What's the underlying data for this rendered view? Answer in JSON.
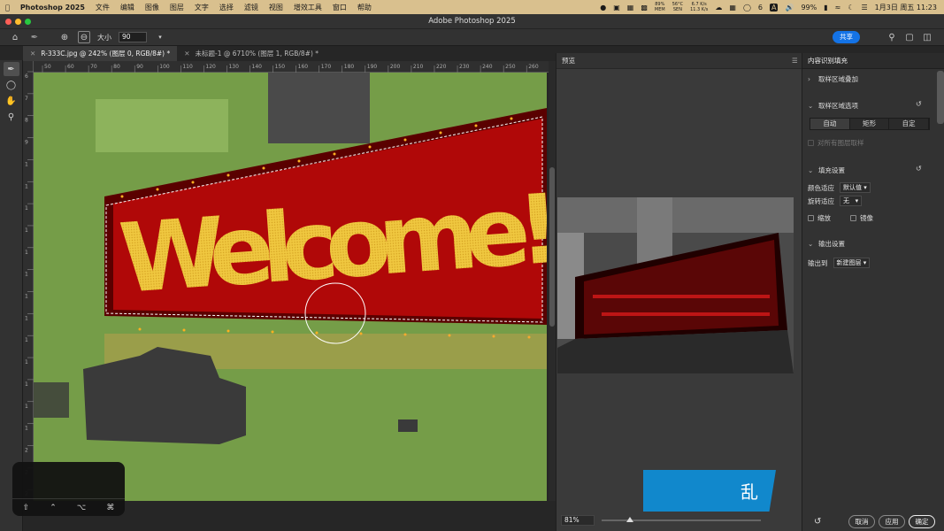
{
  "menubar": {
    "app_name": "Photoshop 2025",
    "items": [
      "文件",
      "编辑",
      "图像",
      "图层",
      "文字",
      "选择",
      "滤镜",
      "视图",
      "增效工具",
      "窗口",
      "帮助"
    ],
    "status": {
      "cpu": "89%",
      "cpu_label": "MEM",
      "temp": "56°C",
      "temp_label": "SEN",
      "net_up": "6.7 K/s",
      "net_down": "11.3 K/s",
      "wechat_count": "6",
      "input_method": "A",
      "battery": "99%",
      "datetime": "1月3日 周五 11:23"
    }
  },
  "window": {
    "title": "Adobe Photoshop 2025"
  },
  "options": {
    "size_label": "大小",
    "size_value": "90",
    "share_label": "共享"
  },
  "tabs": [
    {
      "label": "R-333C.jpg @ 242% (图层 0, RGB/8#) *",
      "active": true
    },
    {
      "label": "未标题-1 @ 6710% (图层 1, RGB/8#) *",
      "active": false
    }
  ],
  "ruler_h": [
    "50",
    "60",
    "70",
    "80",
    "90",
    "100",
    "110",
    "120",
    "130",
    "140",
    "150",
    "160",
    "170",
    "180",
    "190",
    "200",
    "210",
    "220",
    "230",
    "240",
    "250",
    "260"
  ],
  "ruler_v": [
    "6",
    "7",
    "8",
    "9",
    "1",
    "1",
    "1",
    "1",
    "1",
    "1",
    "1",
    "1",
    "1",
    "1",
    "1",
    "1",
    "1",
    "2",
    "2",
    "2"
  ],
  "canvas": {
    "sign_text": "Welcome!"
  },
  "preview": {
    "header": "预览",
    "zoom": "81%"
  },
  "panel": {
    "title": "内容识别填充",
    "sampling_overlay": "取样区域叠加",
    "sampling_options": "取样区域选项",
    "sampling_modes": [
      "自动",
      "矩形",
      "自定"
    ],
    "sample_all_layers": "对所有图层取样",
    "fill_settings": "填充设置",
    "color_adapt_label": "颜色适应",
    "color_adapt_value": "默认值",
    "rotation_label": "旋转适应",
    "rotation_value": "无",
    "scale_label": "缩放",
    "mirror_label": "镜像",
    "output_settings": "输出设置",
    "output_to_label": "输出到",
    "output_to_value": "新建图层",
    "cancel": "取消",
    "apply": "应用",
    "ok": "确定"
  },
  "overlay": {
    "banner_text": "乱"
  },
  "keys": [
    "⇧",
    "⌃",
    "⌥",
    "⌘"
  ],
  "colors": {
    "mask_green": "#7fae4a",
    "accent": "#1473e6",
    "led_red": "#d01010",
    "menubar": "#d9c08e"
  }
}
